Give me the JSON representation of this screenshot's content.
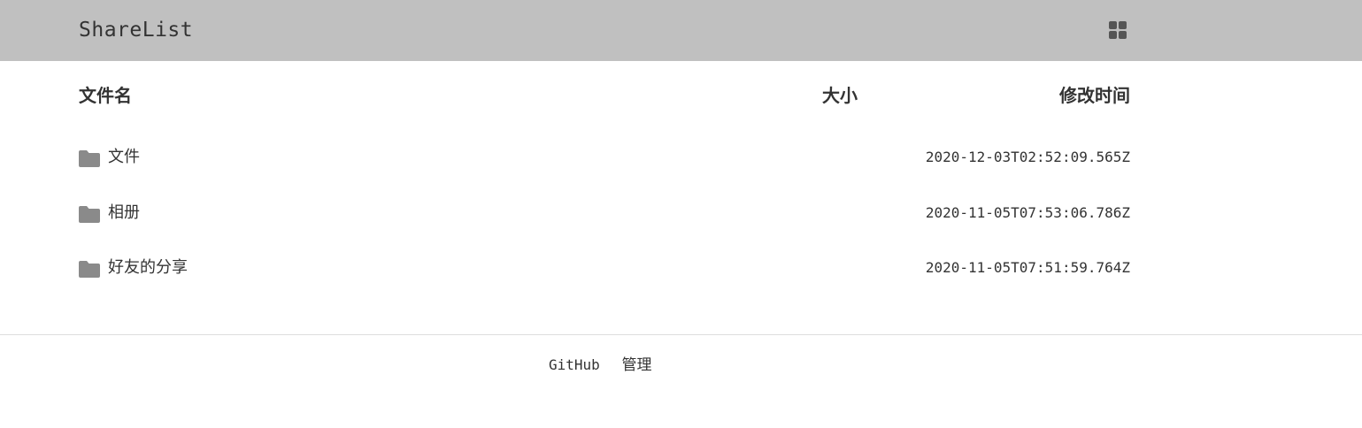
{
  "header": {
    "brand": "ShareList",
    "view_toggle_icon": "grid-view-icon"
  },
  "table": {
    "columns": {
      "name": "文件名",
      "size": "大小",
      "mtime": "修改时间"
    },
    "rows": [
      {
        "icon": "folder-icon",
        "name": "文件",
        "size": "",
        "mtime": "2020-12-03T02:52:09.565Z"
      },
      {
        "icon": "folder-icon",
        "name": "相册",
        "size": "",
        "mtime": "2020-11-05T07:53:06.786Z"
      },
      {
        "icon": "folder-icon",
        "name": "好友的分享",
        "size": "",
        "mtime": "2020-11-05T07:51:59.764Z"
      }
    ]
  },
  "footer": {
    "github_label": "GitHub",
    "admin_label": "管理"
  },
  "colors": {
    "header_bg": "#c0c0c0",
    "text": "#333333",
    "icon": "#8a8a8a"
  }
}
